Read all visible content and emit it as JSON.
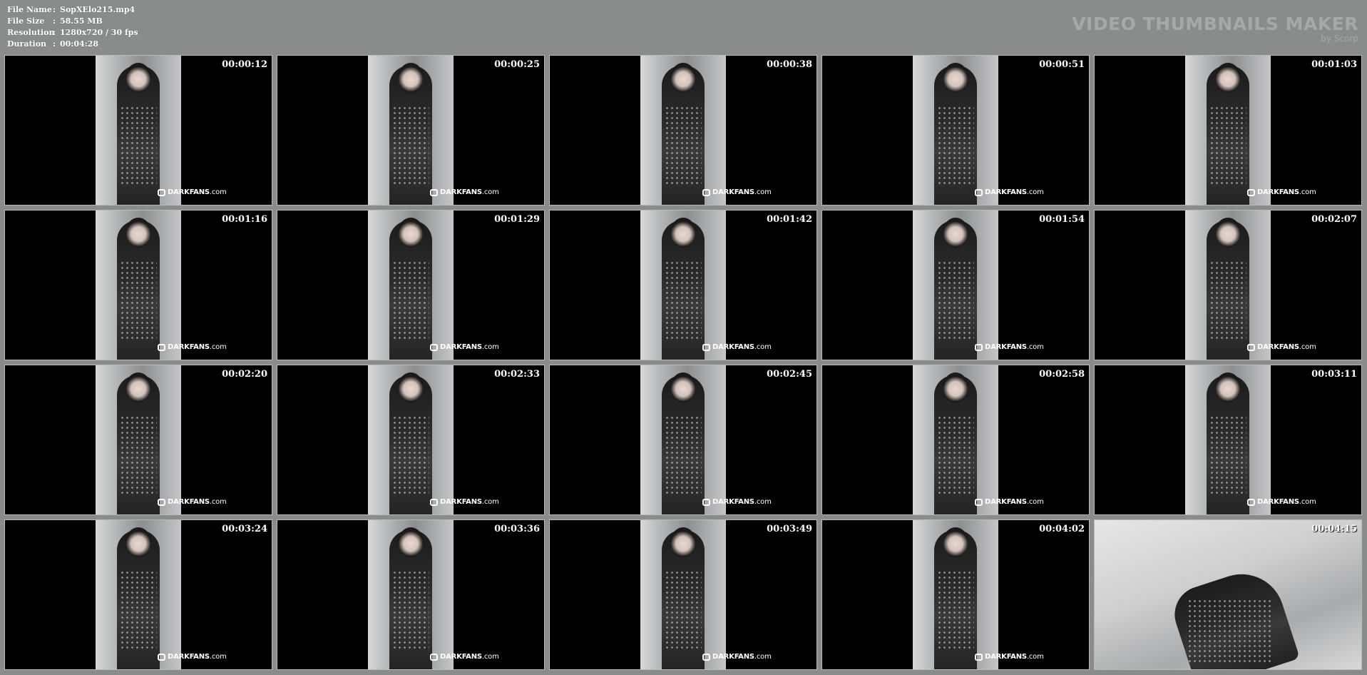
{
  "file_info": {
    "rows": [
      {
        "key": "File Name",
        "sep": ":",
        "value": "SopXElo215.mp4"
      },
      {
        "key": "File Size",
        "sep": ":",
        "value": "58.55 MB"
      },
      {
        "key": "Resolution",
        "sep": ":",
        "value": "1280x720 / 30 fps"
      },
      {
        "key": "Duration",
        "sep": ":",
        "value": "00:04:28"
      }
    ]
  },
  "brand": {
    "title": "VIDEO THUMBNAILS MAKER",
    "subtitle": "by Scorp"
  },
  "watermark": {
    "bold": "DARKFANS",
    "suffix": ".com"
  },
  "thumbnails": [
    {
      "timestamp": "00:00:12"
    },
    {
      "timestamp": "00:00:25"
    },
    {
      "timestamp": "00:00:38"
    },
    {
      "timestamp": "00:00:51"
    },
    {
      "timestamp": "00:01:03"
    },
    {
      "timestamp": "00:01:16"
    },
    {
      "timestamp": "00:01:29"
    },
    {
      "timestamp": "00:01:42"
    },
    {
      "timestamp": "00:01:54"
    },
    {
      "timestamp": "00:02:07"
    },
    {
      "timestamp": "00:02:20"
    },
    {
      "timestamp": "00:02:33"
    },
    {
      "timestamp": "00:02:45"
    },
    {
      "timestamp": "00:02:58"
    },
    {
      "timestamp": "00:03:11"
    },
    {
      "timestamp": "00:03:24"
    },
    {
      "timestamp": "00:03:36"
    },
    {
      "timestamp": "00:03:49"
    },
    {
      "timestamp": "00:04:02"
    },
    {
      "timestamp": "00:04:15"
    }
  ],
  "colors": {
    "background": "#8a8c8c",
    "brand_text": "#a7a9a9"
  }
}
